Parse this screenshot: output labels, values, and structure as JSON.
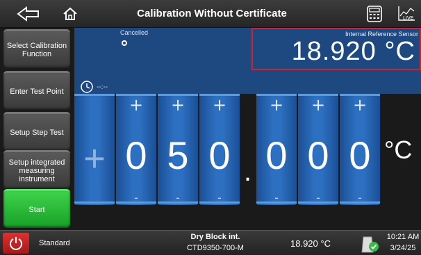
{
  "header": {
    "title": "Calibration Without Certificate"
  },
  "sidebar": {
    "items": [
      {
        "label": "Select Calibration Function"
      },
      {
        "label": "Enter Test Point"
      },
      {
        "label": "Setup Step Test"
      },
      {
        "label": "Setup integrated measuring instrument"
      },
      {
        "label": "Start"
      }
    ]
  },
  "status": {
    "state": "Cancelled",
    "reference_label": "Internal Reference Sensor",
    "reference_value": "18.920 °C",
    "timer": "--:--"
  },
  "setpoint": {
    "sign": "+",
    "digits": [
      "0",
      "5",
      "0",
      "0",
      "0",
      "0"
    ],
    "decimal": ".",
    "unit": "°C",
    "plus": "+",
    "minus": "-"
  },
  "footer": {
    "mode": "Standard",
    "device_type": "Dry Block int.",
    "device_model": "CTD9350-700-M",
    "temperature": "18.920 °C",
    "time": "10:21 AM",
    "date": "3/24/25"
  },
  "colors": {
    "accent": "#2d6fc0",
    "start": "#2ab83a",
    "alert": "#d8202a"
  }
}
